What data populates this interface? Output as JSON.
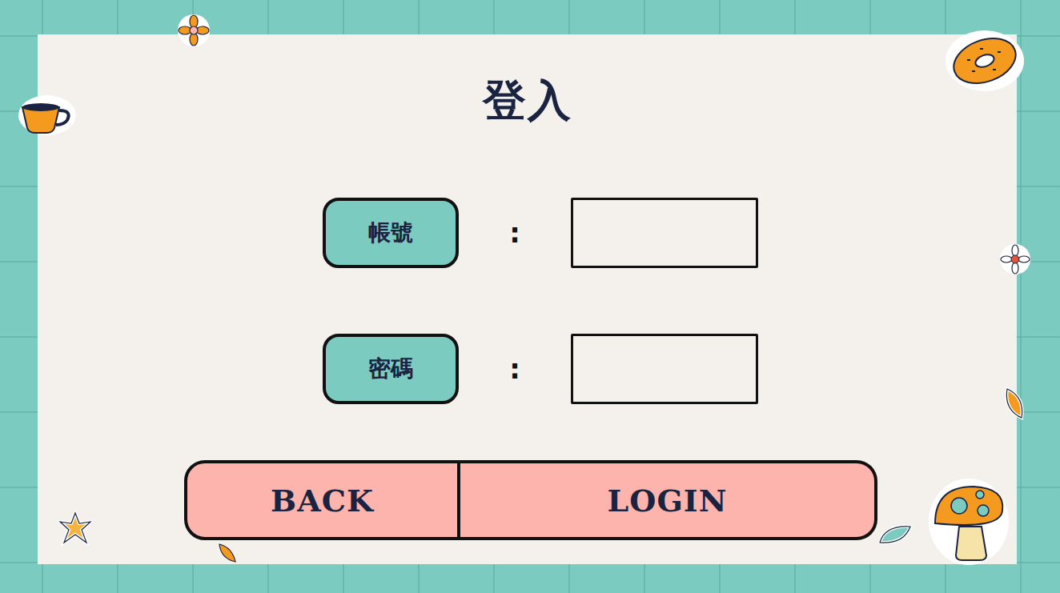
{
  "title": "登入",
  "fields": [
    {
      "label": "帳號",
      "separator": ":",
      "value": ""
    },
    {
      "label": "密碼",
      "separator": ":",
      "value": ""
    }
  ],
  "buttons": [
    {
      "label": "BACK"
    },
    {
      "label": "LOGIN"
    }
  ]
}
